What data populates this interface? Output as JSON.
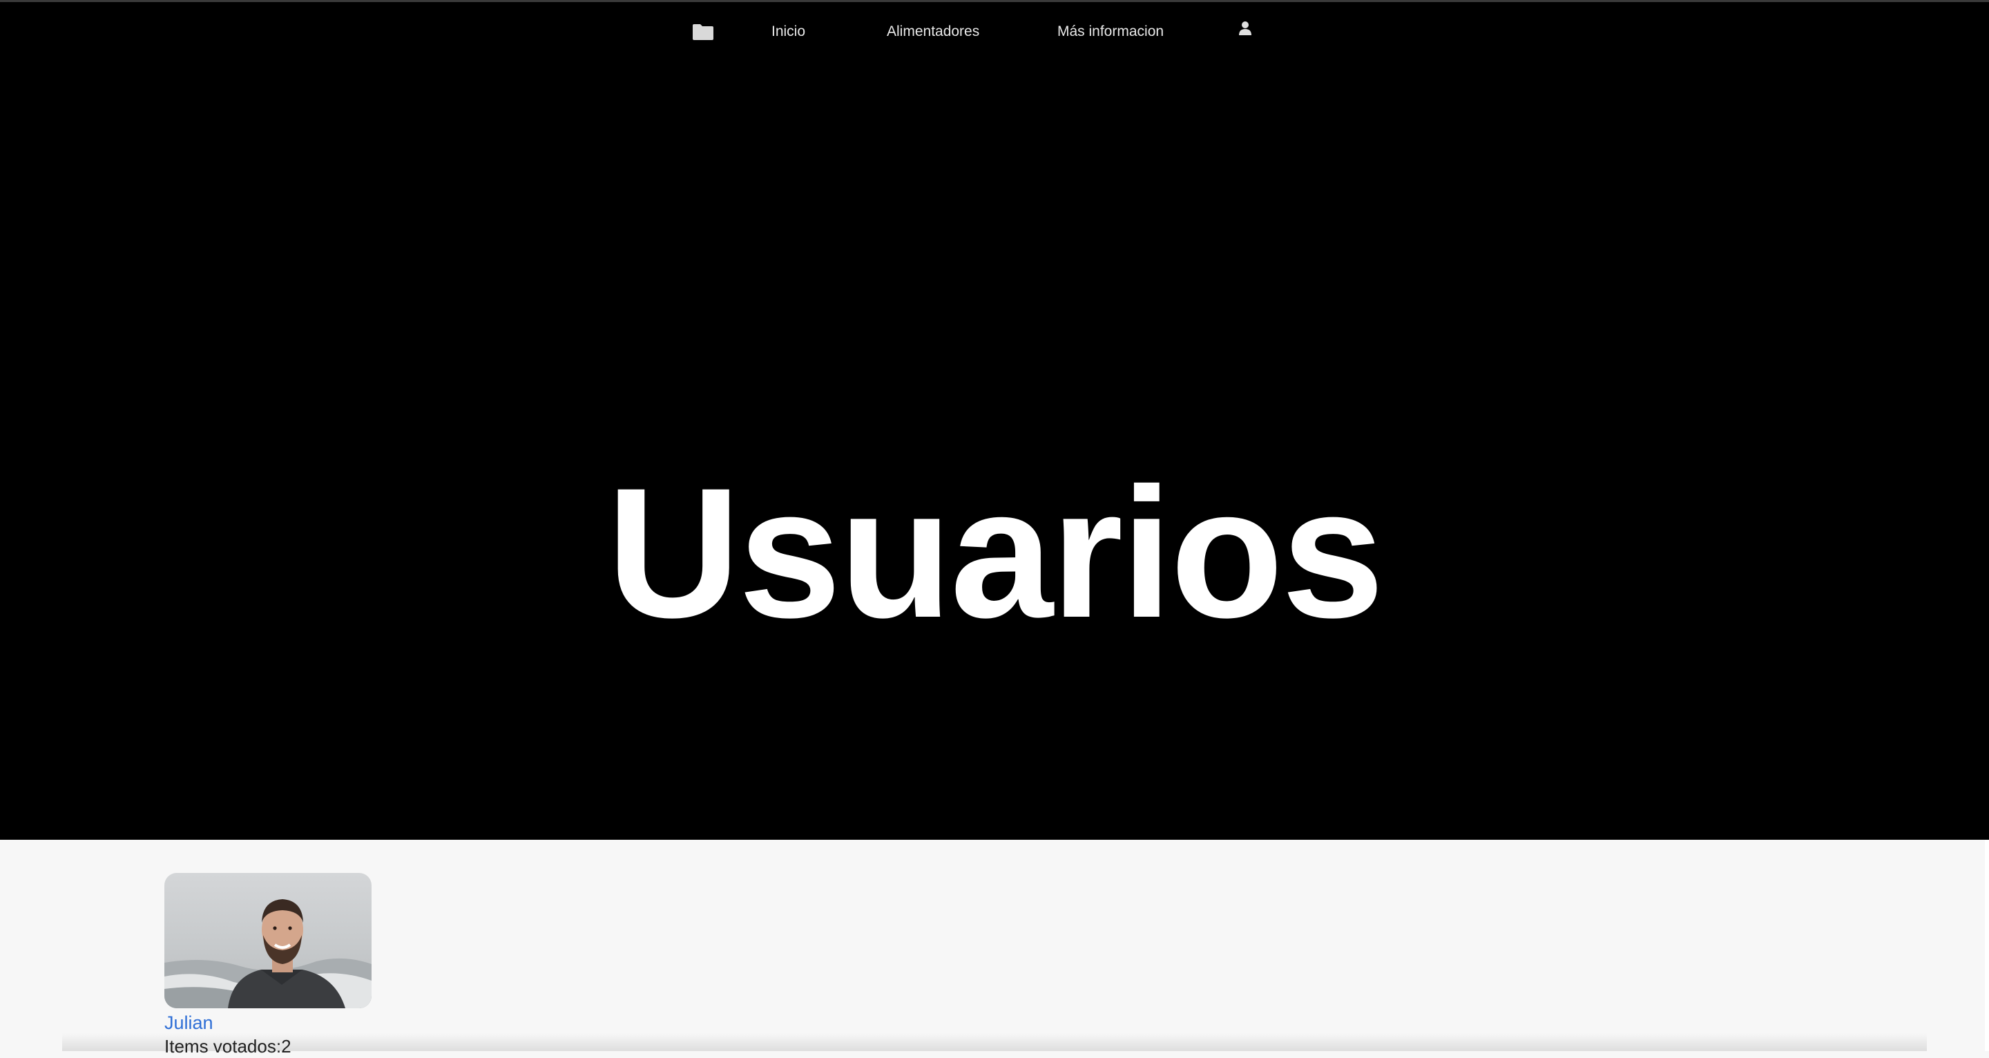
{
  "nav": {
    "folder_icon": "folder-icon",
    "items": [
      {
        "label": "Inicio"
      },
      {
        "label": "Alimentadores"
      },
      {
        "label": "Más informacion"
      }
    ],
    "user_icon": "user-icon"
  },
  "hero": {
    "title": "Usuarios"
  },
  "users": [
    {
      "name": "Julian",
      "votes_text": "Items votados:2"
    }
  ],
  "colors": {
    "hero_background": "#000000",
    "content_background": "#f7f7f7",
    "link": "#2f6fd6"
  }
}
